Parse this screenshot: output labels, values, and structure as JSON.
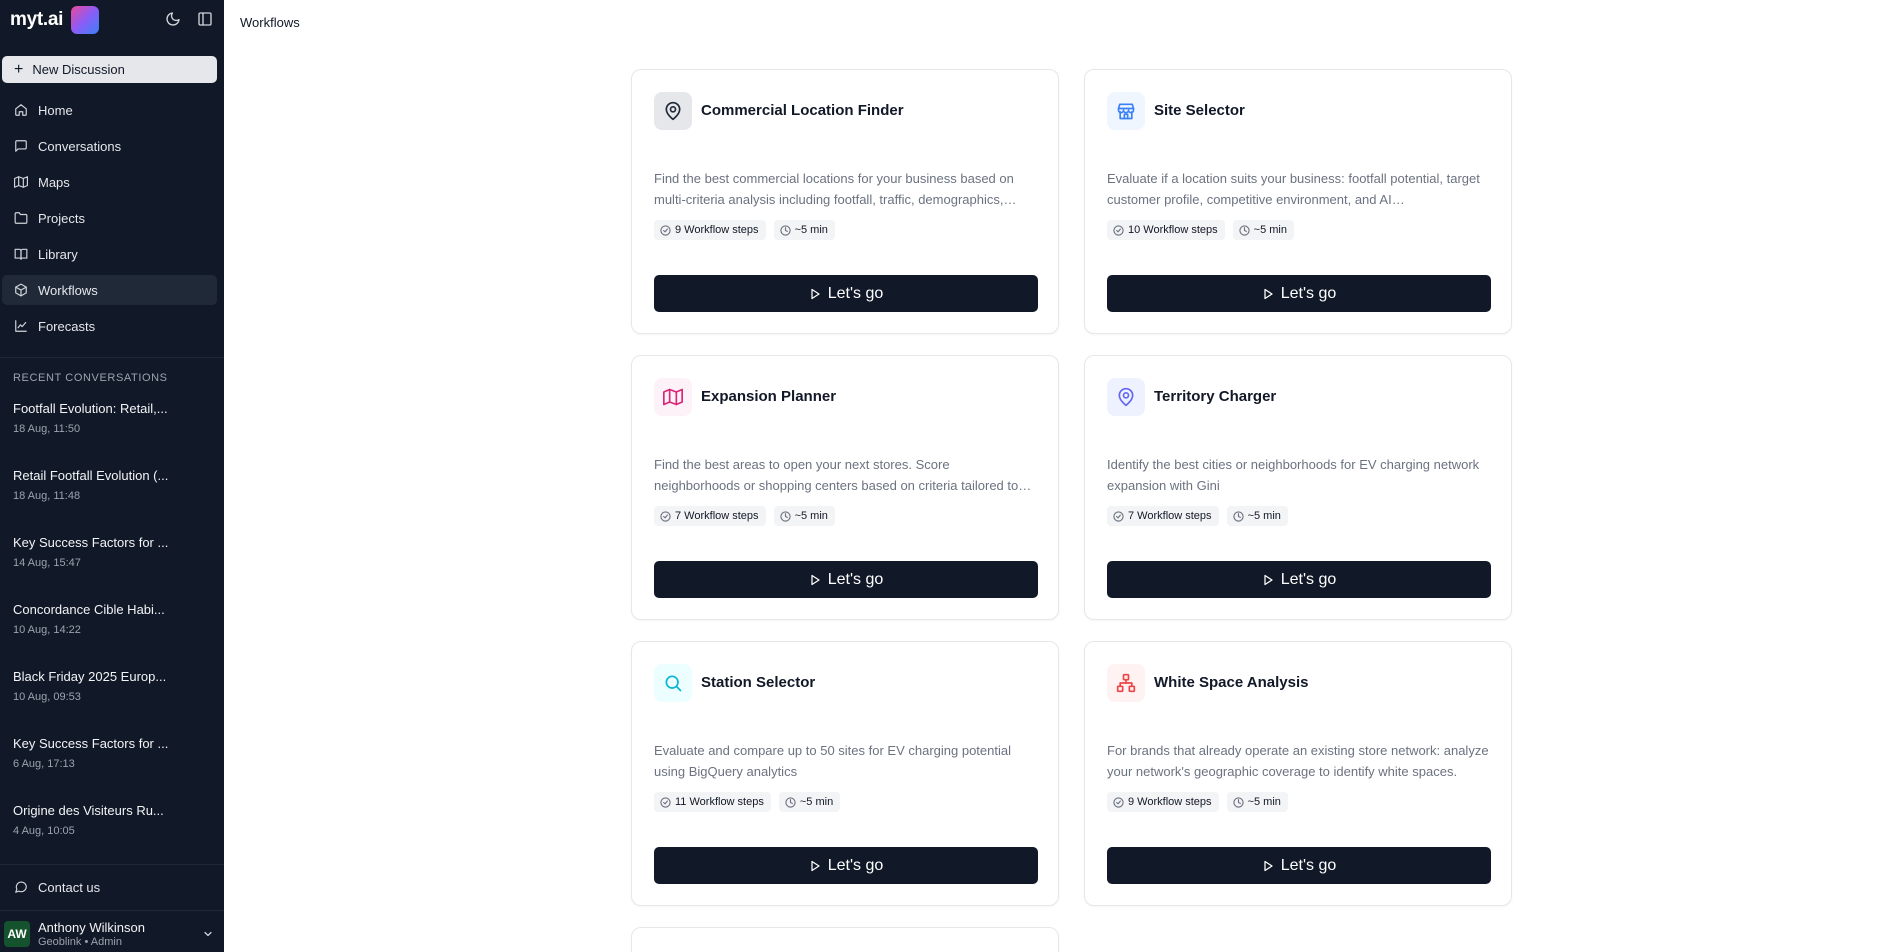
{
  "brand": {
    "name": "myt.ai"
  },
  "sidebar": {
    "new_discussion": "New Discussion",
    "nav": [
      {
        "label": "Home",
        "icon": "home-icon"
      },
      {
        "label": "Conversations",
        "icon": "chat-icon"
      },
      {
        "label": "Maps",
        "icon": "map-icon"
      },
      {
        "label": "Projects",
        "icon": "folder-icon"
      },
      {
        "label": "Library",
        "icon": "book-icon"
      },
      {
        "label": "Workflows",
        "icon": "workflow-icon",
        "active": true
      },
      {
        "label": "Forecasts",
        "icon": "chart-icon"
      }
    ],
    "recent_title": "RECENT CONVERSATIONS",
    "recent": [
      {
        "title": "Footfall Evolution: Retail,...",
        "date": "18 Aug, 11:50"
      },
      {
        "title": "Retail Footfall Evolution (...",
        "date": "18 Aug, 11:48"
      },
      {
        "title": "Key Success Factors for ...",
        "date": "14 Aug, 15:47"
      },
      {
        "title": "Concordance Cible Habi...",
        "date": "10 Aug, 14:22"
      },
      {
        "title": "Black Friday 2025 Europ...",
        "date": "10 Aug, 09:53"
      },
      {
        "title": "Key Success Factors for ...",
        "date": "6 Aug, 17:13"
      },
      {
        "title": "Origine des Visiteurs Ru...",
        "date": "4 Aug, 10:05"
      }
    ],
    "contact": "Contact us",
    "user": {
      "initials": "AW",
      "name": "Anthony Wilkinson",
      "subtitle": "Geoblink • Admin"
    }
  },
  "header": {
    "breadcrumb": "Workflows"
  },
  "cards": [
    {
      "title": "Commercial Location Finder",
      "desc": "Find the best commercial locations for your business based on multi-criteria analysis including footfall, traffic, demographics, competition and more.",
      "steps": "9 Workflow steps",
      "time": "~5 min",
      "button": "Let's go",
      "icon": "location-pin-icon",
      "icon_color": "#1f2937",
      "icon_bg": "#e5e7eb"
    },
    {
      "title": "Site Selector",
      "desc": "Evaluate if a location suits your business: footfall potential, target customer profile, competitive environment, and AI recommendations.",
      "steps": "10 Workflow steps",
      "time": "~5 min",
      "button": "Let's go",
      "icon": "store-icon",
      "icon_color": "#3b82f6",
      "icon_bg": "#eff6ff"
    },
    {
      "title": "Expansion Planner",
      "desc": "Find the best areas to open your next stores. Score neighborhoods or shopping centers based on criteria tailored to your brand.",
      "steps": "7 Workflow steps",
      "time": "~5 min",
      "button": "Let's go",
      "icon": "map-icon",
      "icon_color": "#db2777",
      "icon_bg": "#fdf2f8"
    },
    {
      "title": "Territory Charger",
      "desc": "Identify the best cities or neighborhoods for EV charging network expansion with Gini",
      "steps": "7 Workflow steps",
      "time": "~5 min",
      "button": "Let's go",
      "icon": "location-pin-icon",
      "icon_color": "#6366f1",
      "icon_bg": "#eef2ff"
    },
    {
      "title": "Station Selector",
      "desc": "Evaluate and compare up to 50 sites for EV charging potential using BigQuery analytics",
      "steps": "11 Workflow steps",
      "time": "~5 min",
      "button": "Let's go",
      "icon": "search-icon",
      "icon_color": "#06b6d4",
      "icon_bg": "#ecfeff"
    },
    {
      "title": "White Space Analysis",
      "desc": "For brands that already operate an existing store network: analyze your network's geographic coverage to identify white spaces.",
      "steps": "9 Workflow steps",
      "time": "~5 min",
      "button": "Let's go",
      "icon": "network-icon",
      "icon_color": "#ef4444",
      "icon_bg": "#fef2f2"
    }
  ]
}
